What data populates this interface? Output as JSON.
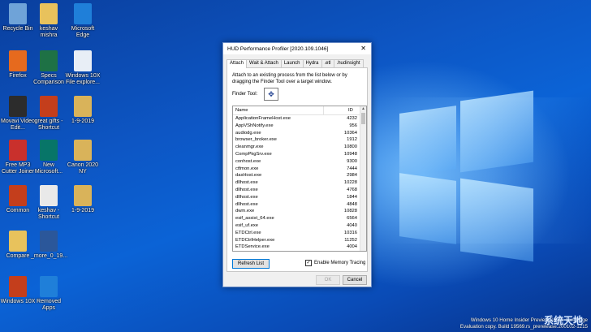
{
  "desktop_icons": [
    {
      "label": "Recycle Bin",
      "icon": "recycle-bin-icon",
      "color": "#6fa3d8"
    },
    {
      "label": "keshav mishra",
      "icon": "folder-user-icon",
      "color": "#e8c25c"
    },
    {
      "label": "Microsoft Edge",
      "icon": "edge-icon",
      "color": "#1f7fd9"
    },
    {
      "label": "Firefox",
      "icon": "firefox-icon",
      "color": "#e66a1e"
    },
    {
      "label": "Specs Comparison",
      "icon": "excel-icon",
      "color": "#1e7145"
    },
    {
      "label": "Windows 10X File explore...",
      "icon": "document-icon",
      "color": "#e8eef6"
    },
    {
      "label": "Movavi Video Edit...",
      "icon": "movavi-icon",
      "color": "#2c2c2c"
    },
    {
      "label": "great gifts - Shortcut",
      "icon": "powerpoint-icon",
      "color": "#c43e1c"
    },
    {
      "label": "1-9-2019",
      "icon": "folder-zip-icon",
      "color": "#d9b35a"
    },
    {
      "label": "Free MP3 Cutter Joiner",
      "icon": "mp3-icon",
      "color": "#c9302c"
    },
    {
      "label": "New Microsoft...",
      "icon": "publisher-icon",
      "color": "#077568"
    },
    {
      "label": "Canon 2020 NY",
      "icon": "folder-zip-icon",
      "color": "#d9b35a"
    },
    {
      "label": "Common",
      "icon": "powerpoint-icon",
      "color": "#c43e1c"
    },
    {
      "label": "keshav - Shortcut",
      "icon": "shortcut-icon",
      "color": "#e9e9e9"
    },
    {
      "label": "1-9-2019",
      "icon": "folder-zip-icon",
      "color": "#d9b35a"
    },
    {
      "label": "Compare",
      "icon": "folder-icon",
      "color": "#e8c25c"
    },
    {
      "label": "_more_0_19...",
      "icon": "word-icon",
      "color": "#2b579a"
    },
    {
      "label": "Windows 10X",
      "icon": "powerpoint-icon",
      "color": "#c43e1c"
    },
    {
      "label": "Removed Apps",
      "icon": "edge-icon",
      "color": "#1f7fd9"
    }
  ],
  "dialog": {
    "title": "HUD Performance Profiler [2020.109.1046]",
    "close": "✕",
    "tabs": [
      "Attach",
      "Wait & Attach",
      "Launch",
      "Hydra",
      ".etl",
      ".hudinsight"
    ],
    "description": "Attach to an existing process from the list below or by dragging the Finder Tool over a target window.",
    "finder_label": "Finder Tool:",
    "finder_icon": "✥",
    "list": {
      "col_name": "Name",
      "col_id": "ID",
      "rows": [
        {
          "name": "ApplicationFrameHost.exe",
          "id": "4232"
        },
        {
          "name": "AppVShNotify.exe",
          "id": "956"
        },
        {
          "name": "audiodg.exe",
          "id": "10364"
        },
        {
          "name": "browser_broker.exe",
          "id": "1912"
        },
        {
          "name": "cleanmgr.exe",
          "id": "10800"
        },
        {
          "name": "CompPkgSrv.exe",
          "id": "10948"
        },
        {
          "name": "conhost.exe",
          "id": "9300"
        },
        {
          "name": "ctfmon.exe",
          "id": "7444"
        },
        {
          "name": "dasHost.exe",
          "id": "2984"
        },
        {
          "name": "dllhost.exe",
          "id": "10228"
        },
        {
          "name": "dllhost.exe",
          "id": "4768"
        },
        {
          "name": "dllhost.exe",
          "id": "1844"
        },
        {
          "name": "dllhost.exe",
          "id": "4848"
        },
        {
          "name": "dwm.exe",
          "id": "10828"
        },
        {
          "name": "esif_assist_64.exe",
          "id": "6564"
        },
        {
          "name": "esif_uf.exe",
          "id": "4040"
        },
        {
          "name": "ETDCtrl.exe",
          "id": "10316"
        },
        {
          "name": "ETDCtrlHelper.exe",
          "id": "11252"
        },
        {
          "name": "ETDService.exe",
          "id": "4004"
        }
      ]
    },
    "refresh_label": "Refresh List",
    "memory_tracing_label": "Enable Memory Tracing",
    "memory_tracing_checked": "✓",
    "ok_label": "OK",
    "cancel_label": "Cancel"
  },
  "watermark": {
    "line1": "Windows 10 Home Insider Preview Single Language",
    "line2": "Evaluation copy. Build 19569.rs_prerelease.200102-1215"
  },
  "corner_logo": "系统天地"
}
